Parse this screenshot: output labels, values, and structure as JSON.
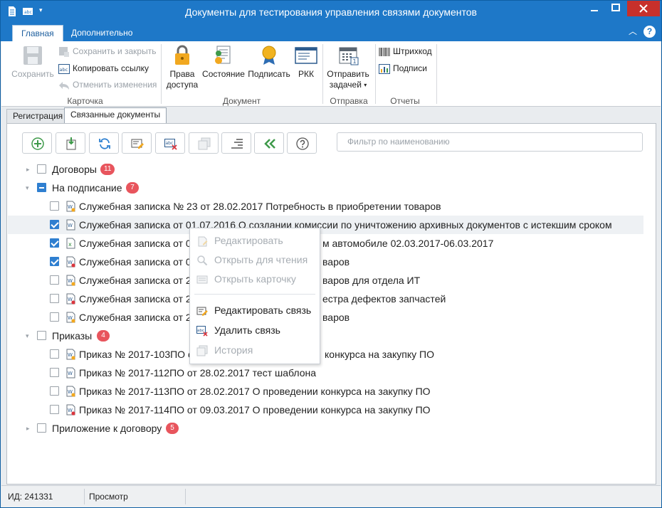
{
  "window": {
    "title": "Документы для тестирования управления связями документов"
  },
  "ribbon_tabs": {
    "home": "Главная",
    "extra": "Дополнительно"
  },
  "ribbon": {
    "card_group": {
      "label": "Карточка",
      "save": "Сохранить",
      "save_close": "Сохранить и закрыть",
      "copy_link": "Копировать ссылку",
      "undo": "Отменить изменения"
    },
    "document_group": {
      "label": "Документ",
      "rights": "Права доступа",
      "state": "Состояние",
      "sign": "Подписать",
      "rkk": "РКК"
    },
    "send_group": {
      "label": "Отправка",
      "send_task": "Отправить задачей"
    },
    "reports_group": {
      "label": "Отчеты",
      "barcode": "Штрихкод",
      "signatures": "Подписи"
    }
  },
  "doc_tabs": {
    "registration": "Регистрация",
    "linked": "Связанные документы"
  },
  "filter": {
    "placeholder": "Фильтр по наименованию"
  },
  "tree": {
    "contracts": {
      "label": "Договоры",
      "count": "11"
    },
    "signing": {
      "label": "На подписание",
      "count": "7",
      "items": [
        "Служебная записка № 23 от 28.02.2017 Потребность в приобретении товаров",
        "Служебная записка от 01.07.2016 О создании комиссии по уничтожению архивных документов с истекшим сроком",
        "Служебная записка от 0",
        "Служебная записка от 0",
        "Служебная записка от 2",
        "Служебная записка от 2",
        "Служебная записка от 2"
      ],
      "tails": [
        "",
        "",
        "м автомобиле 02.03.2017-06.03.2017",
        "варов",
        "варов для отдела ИТ",
        "естра дефектов запчастей",
        "варов"
      ]
    },
    "orders": {
      "label": "Приказы",
      "count": "4",
      "items": [
        "Приказ № 2017-103ПО о",
        "Приказ № 2017-112ПО от 28.02.2017 тест шаблона",
        "Приказ № 2017-113ПО от 28.02.2017 О проведении конкурса на закупку ПО",
        "Приказ № 2017-114ПО от 09.03.2017 О проведении конкурса на закупку ПО"
      ],
      "tails": [
        "конкурса на закупку ПО",
        "",
        "",
        ""
      ]
    },
    "appendix": {
      "label": "Приложение к договору",
      "count": "5"
    }
  },
  "context_menu": {
    "edit": "Редактировать",
    "open_read": "Открыть для чтения",
    "open_card": "Открыть карточку",
    "edit_link": "Редактировать связь",
    "delete_link": "Удалить связь",
    "history": "История"
  },
  "status": {
    "id": "ИД: 241331",
    "mode": "Просмотр"
  },
  "colors": {
    "titlebar": "#1e78c8",
    "badge": "#e8555d",
    "checkbox": "#2f7fd0",
    "close": "#c7302b"
  }
}
